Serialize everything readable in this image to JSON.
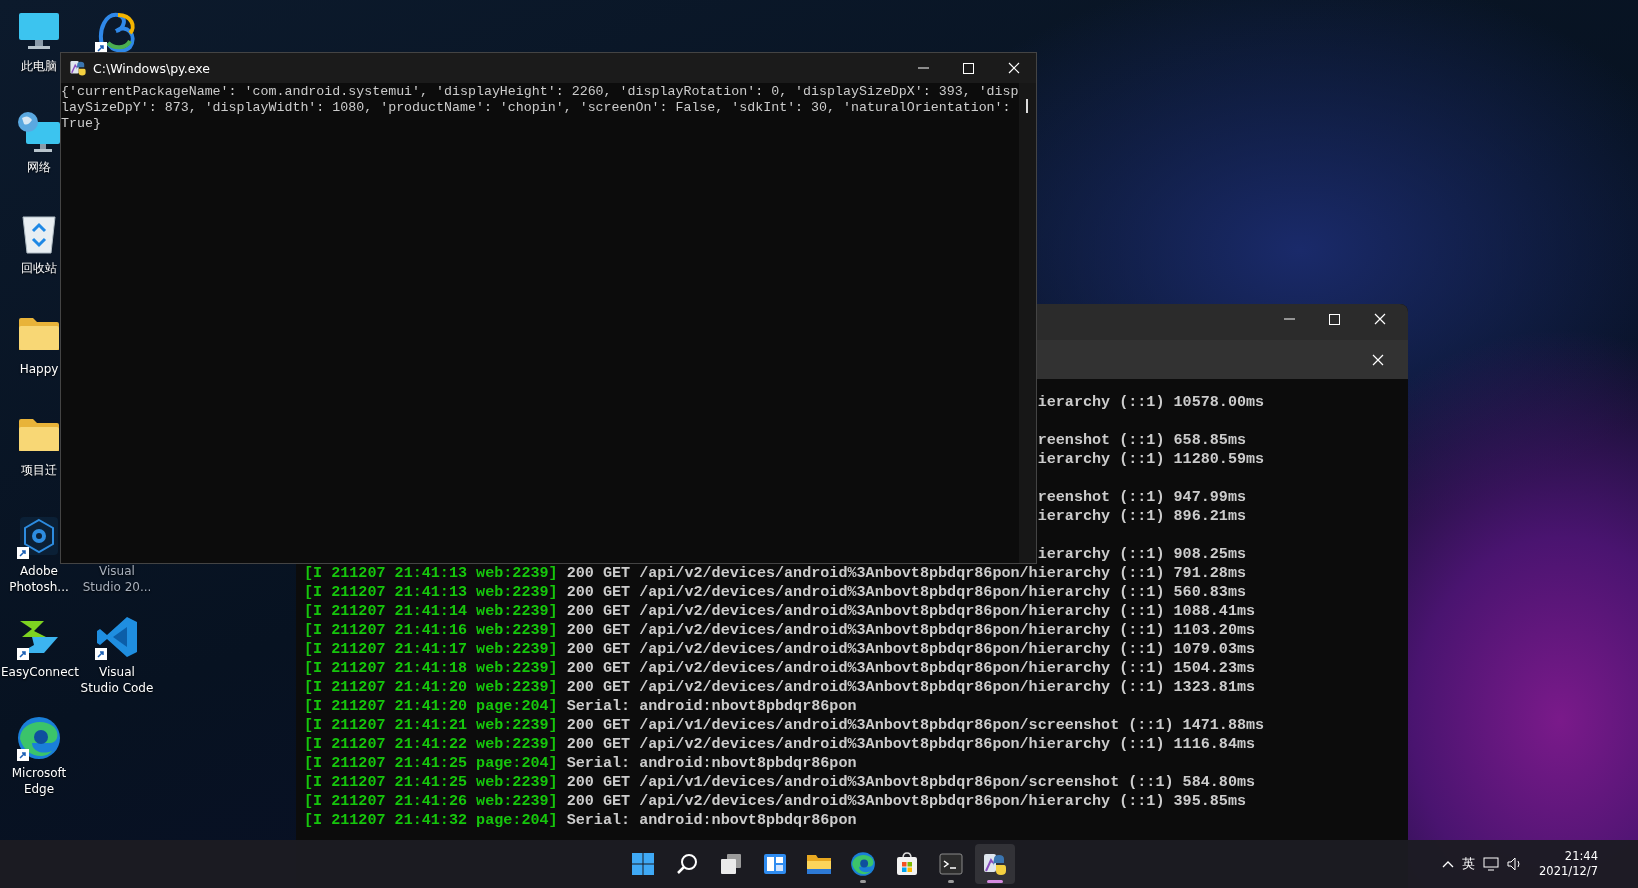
{
  "desktop_rows": [
    [
      {
        "label": "此电脑",
        "kind": "monitor"
      },
      {
        "kind": "navicat"
      }
    ],
    [
      {
        "label": "网络",
        "kind": "network"
      }
    ],
    [
      {
        "label": "回收站",
        "kind": "recycle"
      }
    ],
    [
      {
        "label": "Happy",
        "kind": "folder"
      }
    ],
    [
      {
        "label": "项目迁",
        "kind": "folder"
      }
    ],
    [
      {
        "label": "Adobe Photosh...",
        "kind": "photoshop"
      },
      {
        "label": "Visual Studio 20...",
        "kind": "hidden",
        "dim": true
      }
    ],
    [
      {
        "label": "EasyConnect",
        "kind": "easyconnect"
      },
      {
        "label": "Visual Studio Code",
        "kind": "vscode"
      }
    ],
    [
      {
        "label": "Microsoft Edge",
        "kind": "edge"
      }
    ]
  ],
  "terminal_window": {
    "lines": [
      {
        "kind": "tail",
        "text": "ierarchy (::1) 10578.00ms"
      },
      {
        "kind": "hidden"
      },
      {
        "kind": "tail",
        "text": "reenshot (::1) 658.85ms"
      },
      {
        "kind": "tail",
        "text": "ierarchy (::1) 11280.59ms"
      },
      {
        "kind": "hidden"
      },
      {
        "kind": "tail",
        "text": "reenshot (::1) 947.99ms"
      },
      {
        "kind": "tail",
        "text": "ierarchy (::1) 896.21ms"
      },
      {
        "kind": "hidden"
      },
      {
        "kind": "tail",
        "text": "ierarchy (::1) 908.25ms"
      },
      {
        "kind": "log",
        "tag": "[I 211207 21:41:13 web:2239]",
        "text": "200 GET /api/v2/devices/android%3Anbovt8pbdqr86pon/hierarchy (::1) 791.28ms"
      },
      {
        "kind": "log",
        "tag": "[I 211207 21:41:13 web:2239]",
        "text": "200 GET /api/v2/devices/android%3Anbovt8pbdqr86pon/hierarchy (::1) 560.83ms"
      },
      {
        "kind": "log",
        "tag": "[I 211207 21:41:14 web:2239]",
        "text": "200 GET /api/v2/devices/android%3Anbovt8pbdqr86pon/hierarchy (::1) 1088.41ms"
      },
      {
        "kind": "log",
        "tag": "[I 211207 21:41:16 web:2239]",
        "text": "200 GET /api/v2/devices/android%3Anbovt8pbdqr86pon/hierarchy (::1) 1103.20ms"
      },
      {
        "kind": "log",
        "tag": "[I 211207 21:41:17 web:2239]",
        "text": "200 GET /api/v2/devices/android%3Anbovt8pbdqr86pon/hierarchy (::1) 1079.03ms"
      },
      {
        "kind": "log",
        "tag": "[I 211207 21:41:18 web:2239]",
        "text": "200 GET /api/v2/devices/android%3Anbovt8pbdqr86pon/hierarchy (::1) 1504.23ms"
      },
      {
        "kind": "log",
        "tag": "[I 211207 21:41:20 web:2239]",
        "text": "200 GET /api/v2/devices/android%3Anbovt8pbdqr86pon/hierarchy (::1) 1323.81ms"
      },
      {
        "kind": "log",
        "tag": "[I 211207 21:41:20 page:204]",
        "text": "Serial: android:nbovt8pbdqr86pon"
      },
      {
        "kind": "log",
        "tag": "[I 211207 21:41:21 web:2239]",
        "text": "200 GET /api/v1/devices/android%3Anbovt8pbdqr86pon/screenshot (::1) 1471.88ms"
      },
      {
        "kind": "log",
        "tag": "[I 211207 21:41:22 web:2239]",
        "text": "200 GET /api/v2/devices/android%3Anbovt8pbdqr86pon/hierarchy (::1) 1116.84ms"
      },
      {
        "kind": "log",
        "tag": "[I 211207 21:41:25 page:204]",
        "text": "Serial: android:nbovt8pbdqr86pon"
      },
      {
        "kind": "log",
        "tag": "[I 211207 21:41:25 web:2239]",
        "text": "200 GET /api/v1/devices/android%3Anbovt8pbdqr86pon/screenshot (::1) 584.80ms"
      },
      {
        "kind": "log",
        "tag": "[I 211207 21:41:26 web:2239]",
        "text": "200 GET /api/v2/devices/android%3Anbovt8pbdqr86pon/hierarchy (::1) 395.85ms"
      },
      {
        "kind": "log",
        "tag": "[I 211207 21:41:32 page:204]",
        "text": "Serial: android:nbovt8pbdqr86pon"
      }
    ]
  },
  "py_window": {
    "title": "C:\\Windows\\py.exe",
    "lines": [
      "{'currentPackageName': 'com.android.systemui', 'displayHeight': 2260, 'displayRotation': 0, 'displaySizeDpX': 393, 'disp",
      "laySizeDpY': 873, 'displayWidth': 1080, 'productName': 'chopin', 'screenOn': False, 'sdkInt': 30, 'naturalOrientation':",
      "True}"
    ]
  },
  "taskbar": {
    "apps": [
      {
        "kind": "start",
        "running": false,
        "active": false
      },
      {
        "kind": "search",
        "running": false,
        "active": false
      },
      {
        "kind": "taskview",
        "running": false,
        "active": false
      },
      {
        "kind": "widgets",
        "running": false,
        "active": false
      },
      {
        "kind": "explorer",
        "running": false,
        "active": false
      },
      {
        "kind": "edge",
        "running": true,
        "active": false
      },
      {
        "kind": "store",
        "running": false,
        "active": false
      },
      {
        "kind": "terminal",
        "running": true,
        "active": false
      },
      {
        "kind": "python",
        "running": true,
        "active": true
      }
    ],
    "tray": {
      "language": "英",
      "time": "21:44",
      "date": "2021/12/7"
    }
  }
}
